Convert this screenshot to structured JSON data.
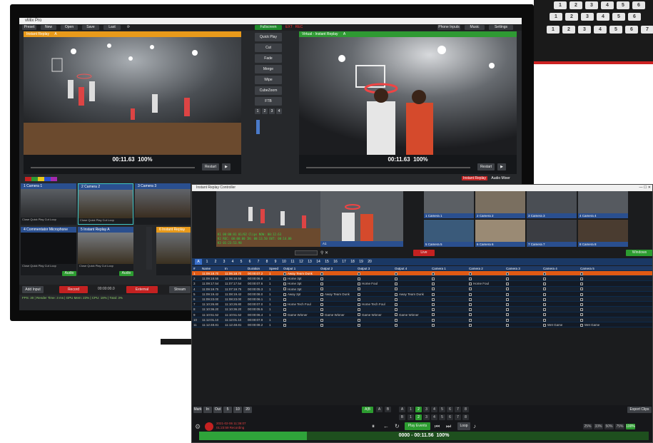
{
  "vmix": {
    "title": "vMix Pro",
    "menu": [
      "Preset",
      "New",
      "Open",
      "Save",
      "Last"
    ],
    "fullscreen_label": "Fullscreen",
    "ext_label": "EXT",
    "rec_label": "REC",
    "right_menu": [
      "Phone Inputs",
      "Music",
      "Settings"
    ],
    "preview": {
      "label": "Instant Replay",
      "num": "A",
      "time": "00:11.63",
      "zoom": "100%"
    },
    "output": {
      "label": "Virtual - Instant Replay",
      "num": "A",
      "time": "00:11.63",
      "zoom": "100%"
    },
    "restart_label": "Restart",
    "transitions": [
      "Quick Play",
      "Cut",
      "Fade",
      "Merge",
      "Wipe",
      "CubeZoom",
      "FTB"
    ],
    "trans_nums": [
      "1",
      "2",
      "3",
      "4"
    ],
    "instant_replay_status": "Instant Replay",
    "audio_mixer_label": "Audio Mixer",
    "inputs": [
      {
        "num": "1",
        "label": "Camera 1"
      },
      {
        "num": "2",
        "label": "Camera 2"
      },
      {
        "num": "3",
        "label": "Camera 3"
      },
      {
        "num": "4",
        "label": "Commentator Microphone"
      },
      {
        "num": "5",
        "label": "Instant Replay A"
      },
      {
        "num": "6",
        "label": "Instant Replay"
      }
    ],
    "input_controls": [
      "Close",
      "Quick Play",
      "Cut",
      "Loop"
    ],
    "audio_label": "Audio",
    "bottom": {
      "add_input": "Add Input",
      "record": "Record",
      "record_time": "00:00:00.0",
      "external": "External",
      "stream": "Stream"
    },
    "status_line": "FPS: 30 | Render Time: 3 ms | GPU Mem: 23% | CPU: 18% | Total: 3%"
  },
  "keyboard_keys": [
    "1",
    "2",
    "3",
    "4",
    "5",
    "6",
    "7",
    "8",
    "1",
    "2",
    "3",
    "4",
    "5",
    "6",
    "7",
    "8"
  ],
  "replay": {
    "title": "Instant Replay Controller",
    "preview_info": {
      "line1": "K1  00:00:01  01/02 Clips   NOW: 00:12.63",
      "line2": "K2  REC: 00:00:00  IN: 00:13.50  OUT: 00:14.00",
      "line3": "K3  01:23:53.98"
    },
    "output_label": "A1",
    "cameras": [
      "Camera 1",
      "Camera 2",
      "Camera 3",
      "Camera 4",
      "Camera 5",
      "Camera 6",
      "Camera 7",
      "Camera 8"
    ],
    "camera_nums": [
      "1",
      "2",
      "3",
      "4",
      "5",
      "6",
      "7",
      "8"
    ],
    "live_label": "Live",
    "windows_label": "Windows",
    "tabs": [
      "A",
      "1",
      "2",
      "3",
      "4",
      "5",
      "6",
      "7",
      "8",
      "9",
      "10",
      "11",
      "12",
      "13",
      "14",
      "15",
      "16",
      "17",
      "18",
      "19",
      "20"
    ],
    "columns": [
      "#",
      "Name",
      "In",
      "Duration",
      "Speed",
      "Output 1",
      "Output 2",
      "Output 3",
      "Output 4",
      "Camera 1",
      "Camera 2",
      "Camera 3",
      "Camera 4",
      "Camera 5"
    ],
    "events": [
      [
        "1",
        "11:09:18.70",
        "11:06:18.70",
        "00:00:07.2",
        "1",
        "Away Team Dunk",
        "",
        "",
        "",
        "",
        "",
        "",
        "",
        ""
      ],
      [
        "2",
        "11:09:18.55",
        "11:06:18.55",
        "00:00:06.8",
        "1",
        "Home 3pt",
        "",
        "",
        "",
        "",
        "",
        "",
        "",
        ""
      ],
      [
        "3",
        "11:09:17.54",
        "11:07:17.54",
        "00:00:07.6",
        "1",
        "Home 3pt",
        "",
        "Home Foul",
        "",
        "",
        "Home Foul",
        "",
        "",
        ""
      ],
      [
        "4",
        "11:09:19.75",
        "11:07:19.75",
        "00:00:05.3",
        "1",
        "Home 3pt",
        "",
        "",
        "",
        "",
        "",
        "",
        "",
        ""
      ],
      [
        "5",
        "11:09:19.42",
        "11:08:19.42",
        "00:00:08.0",
        "1",
        "Away 2pt",
        "Away Team Dunk",
        "",
        "Away Team Dunk",
        "",
        "",
        "",
        "",
        ""
      ],
      [
        "6",
        "11:09:23.00",
        "11:08:23.00",
        "00:00:06.1",
        "1",
        "",
        "",
        "",
        "",
        "",
        "",
        "",
        "",
        ""
      ],
      [
        "7",
        "11:10:26.80",
        "11:10:26.80",
        "00:00:07.0",
        "1",
        "Home Tech Foul",
        "",
        "Home Tech Foul",
        "",
        "",
        "",
        "",
        "",
        ""
      ],
      [
        "8",
        "11:10:36.20",
        "11:10:36.20",
        "00:00:05.5",
        "1",
        "",
        "",
        "",
        "",
        "",
        "",
        "",
        "",
        ""
      ],
      [
        "9",
        "11:10:51.52",
        "11:10:51.52",
        "00:00:06.4",
        "1",
        "Game Winner",
        "Game Winner",
        "Game Winner",
        "Game Winner",
        "",
        "",
        "",
        "",
        ""
      ],
      [
        "10",
        "11:12:01.10",
        "11:12:01.10",
        "00:00:07.9",
        "1",
        "",
        "",
        "",
        "",
        "",
        "",
        "",
        "",
        ""
      ],
      [
        "11",
        "11:12:48.81",
        "11:12:48.81",
        "00:00:08.2",
        "1",
        "",
        "",
        "",
        "",
        "",
        "",
        "",
        "Wet Game",
        "Wet Game"
      ]
    ],
    "mark_controls": [
      "Mark",
      "In",
      "Out",
      "5",
      "10",
      "20"
    ],
    "ab_label": "A|B",
    "ab_keys": [
      "A",
      "B"
    ],
    "play_events": "Play Events",
    "loop_label": "Loop",
    "export_clips": "Export Clips",
    "rec_timestamp": "2021-02-06 11:36:07",
    "rec_status": "01:23:59 Recording",
    "position": "0000 - 00:11.56",
    "position_zoom": "100%",
    "speed_presets": [
      "25%",
      "33%",
      "50%",
      "75%",
      "100%"
    ],
    "selected_speed": "100%",
    "progress_fraction": 0.24
  },
  "colors": {
    "accent_orange": "#e89a1b",
    "accent_green": "#2f9a33",
    "accent_red": "#c42121",
    "accent_blue": "#2a4f8f"
  }
}
